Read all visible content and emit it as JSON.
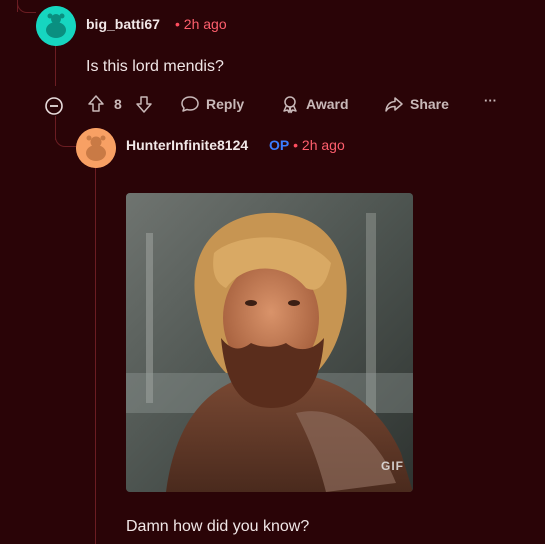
{
  "colors": {
    "background": "#2a0407",
    "thread_line": "#6b1d22",
    "time": "#ff5f6d",
    "op_badge": "#3b7dff"
  },
  "comment1": {
    "username": "big_batti67",
    "separator": "•",
    "time": "2h ago",
    "body": "Is this lord mendis?",
    "votes": "8",
    "reply_label": "Reply",
    "award_label": "Award",
    "share_label": "Share",
    "more_label": "···"
  },
  "comment2": {
    "username": "HunterInfinite8124",
    "op_label": "OP",
    "separator": "•",
    "time": "2h ago",
    "gif_badge": "GIF",
    "body": "Damn how did you know?"
  },
  "icons": {
    "collapse": "collapse-minus-icon",
    "upvote": "upvote-arrow-icon",
    "downvote": "downvote-arrow-icon",
    "reply": "speech-bubble-icon",
    "award": "award-ribbon-icon",
    "share": "share-arrow-icon",
    "more": "ellipsis-icon"
  }
}
